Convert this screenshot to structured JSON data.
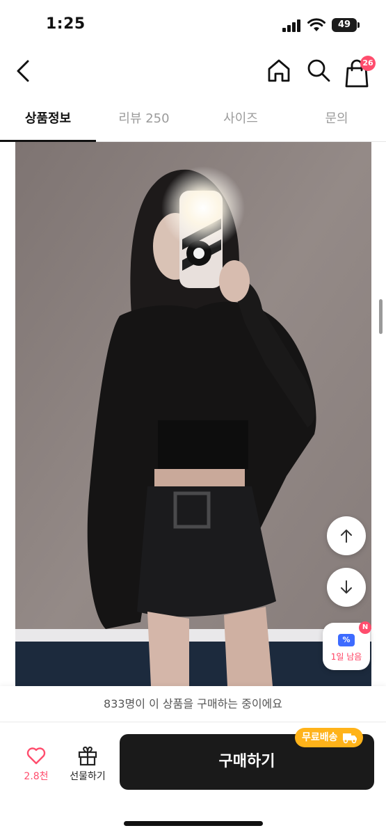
{
  "status_bar": {
    "time": "1:25",
    "battery": "49"
  },
  "top_nav": {
    "cart_count": "26"
  },
  "tabs": [
    {
      "label": "상품정보",
      "active": true
    },
    {
      "label": "리뷰 250",
      "active": false
    },
    {
      "label": "사이즈",
      "active": false
    },
    {
      "label": "문의",
      "active": false
    }
  ],
  "product": {
    "image_icon": "product-photo"
  },
  "floating": {
    "coupon_label": "1일 남음",
    "coupon_new_badge": "N",
    "coupon_glyph": "%"
  },
  "footer": {
    "buyers_text": "833명이 이 상품을 구매하는 중이에요",
    "like_count": "2.8천",
    "gift_label": "선물하기",
    "buy_label": "구매하기",
    "free_shipping_label": "무료배송"
  },
  "colors": {
    "accent_pink": "#ff4d6d",
    "buy_button": "#1a1a1a",
    "free_shipping": "#ffb31a",
    "coupon_blue": "#3d6bff"
  }
}
